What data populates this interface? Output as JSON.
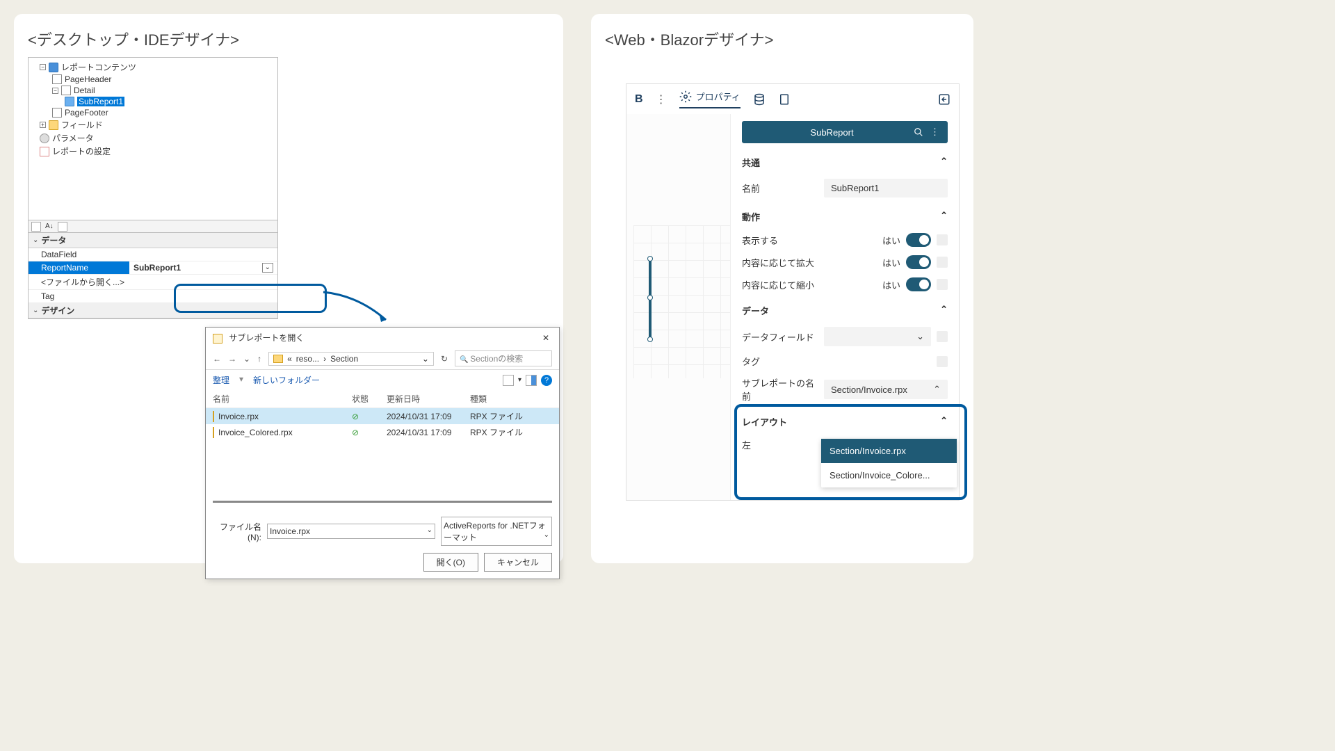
{
  "left": {
    "title": "<デスクトップ・IDEデザイナ>",
    "tree": {
      "root": "レポートコンテンツ",
      "pageHeader": "PageHeader",
      "detail": "Detail",
      "subReport": "SubReport1",
      "pageFooter": "PageFooter",
      "fields": "フィールド",
      "params": "パラメータ",
      "settings": "レポートの設定"
    },
    "props": {
      "dataHeader": "データ",
      "dataField": "DataField",
      "reportName": "ReportName",
      "reportNameValue": "SubReport1",
      "openFromFile": "<ファイルから開く...>",
      "tag": "Tag",
      "designHeader": "デザイン"
    },
    "dialog": {
      "title": "サブレポートを開く",
      "breadcrumb1": "reso...",
      "breadcrumb2": "Section",
      "searchPlaceholder": "Sectionの検索",
      "organize": "整理",
      "newFolder": "新しいフォルダー",
      "colName": "名前",
      "colStatus": "状態",
      "colDate": "更新日時",
      "colType": "種類",
      "files": [
        {
          "name": "Invoice.rpx",
          "date": "2024/10/31 17:09",
          "type": "RPX ファイル"
        },
        {
          "name": "Invoice_Colored.rpx",
          "date": "2024/10/31 17:09",
          "type": "RPX ファイル"
        }
      ],
      "fileNameLabel": "ファイル名(N):",
      "fileNameValue": "Invoice.rpx",
      "filter": "ActiveReports for .NETフォーマット",
      "open": "開く(O)",
      "cancel": "キャンセル"
    }
  },
  "right": {
    "title": "<Web・Blazorデザイナ>",
    "tabs": {
      "properties": "プロパティ"
    },
    "component": "SubReport",
    "sections": {
      "common": "共通",
      "nameLabel": "名前",
      "nameValue": "SubReport1",
      "behavior": "動作",
      "visible": "表示する",
      "canGrow": "内容に応じて拡大",
      "canShrink": "内容に応じて縮小",
      "yes": "はい",
      "data": "データ",
      "dataField": "データフィールド",
      "tag": "タグ",
      "subReportName": "サブレポートの名前",
      "subReportValue": "Section/Invoice.rpx",
      "layout": "レイアウト",
      "left": "左"
    },
    "dropdown": {
      "opt1": "Section/Invoice.rpx",
      "opt2": "Section/Invoice_Colore..."
    }
  }
}
